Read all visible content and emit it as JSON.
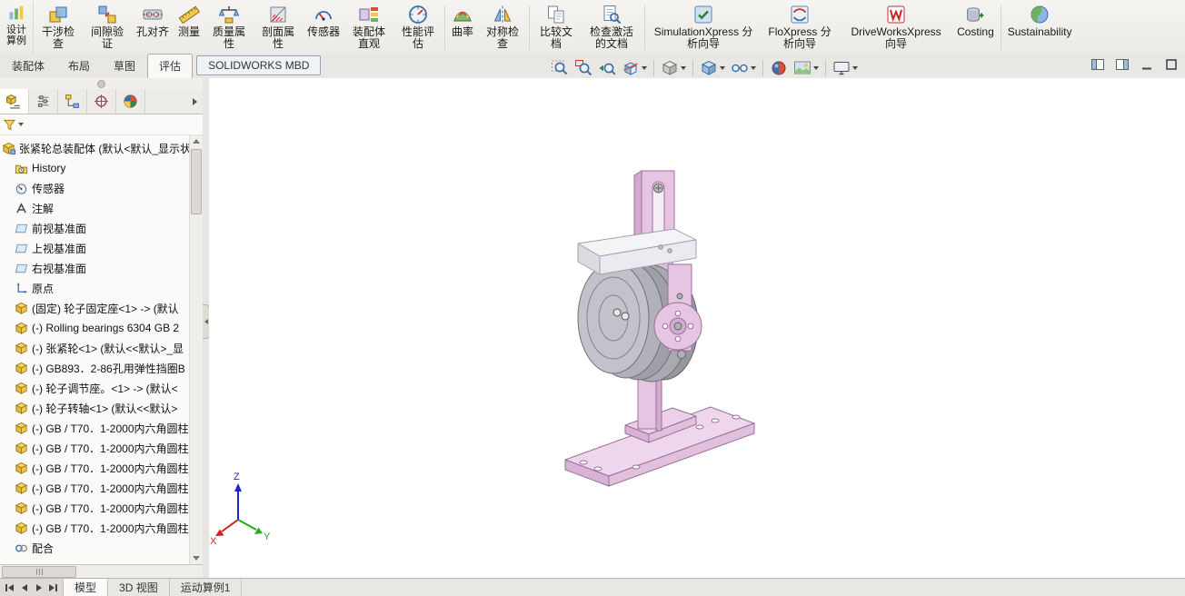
{
  "ribbon": {
    "corner_tool": {
      "label": "设计算例",
      "icon": "design-study"
    },
    "tools": [
      {
        "label": "干涉检查",
        "icon": "interference-detection"
      },
      {
        "label": "间隙验证",
        "icon": "clearance-verification"
      },
      {
        "label": "孔对齐",
        "icon": "hole-alignment"
      },
      {
        "label": "测量",
        "icon": "measure"
      },
      {
        "label": "质量属性",
        "icon": "mass-properties"
      },
      {
        "label": "剖面属性",
        "icon": "section-properties"
      },
      {
        "label": "传感器",
        "icon": "sensor"
      },
      {
        "label": "装配体直观",
        "icon": "assembly-visualization"
      },
      {
        "label": "性能评估",
        "icon": "performance-evaluation"
      },
      {
        "label": "曲率",
        "icon": "curvature"
      },
      {
        "label": "对称检查",
        "icon": "symmetry-check"
      },
      {
        "label": "比较文档",
        "icon": "compare-documents"
      },
      {
        "label": "检查激活的文档",
        "icon": "check-active-document"
      },
      {
        "label": "SimulationXpress 分析向导",
        "icon": "simulationxpress-wizard"
      },
      {
        "label": "FloXpress 分析向导",
        "icon": "floxpress-wizard"
      },
      {
        "label": "DriveWorksXpress 向导",
        "icon": "driveworksxpress-wizard"
      },
      {
        "label": "Costing",
        "icon": "costing"
      },
      {
        "label": "Sustainability",
        "icon": "sustainability"
      }
    ]
  },
  "command_tabs": [
    {
      "label": "装配体",
      "active": false
    },
    {
      "label": "布局",
      "active": false
    },
    {
      "label": "草图",
      "active": false
    },
    {
      "label": "评估",
      "active": true
    },
    {
      "label": "SOLIDWORKS MBD",
      "active": false
    }
  ],
  "headsup_toolbar": {
    "icons": [
      "zoom-to-fit",
      "zoom-to-area",
      "previous-view",
      "section-view",
      "view-orientation",
      "display-style",
      "hide-show-items",
      "edit-appearance",
      "apply-scene",
      "view-settings"
    ]
  },
  "window_controls": {
    "icons": [
      "pane-left",
      "pane-right",
      "minimize",
      "restore"
    ]
  },
  "feature_panel": {
    "tabs": [
      "featuremanager-design-tree",
      "property-manager",
      "configuration-manager",
      "dimxpert-manager",
      "display-manager"
    ],
    "filter_icon": "filter-funnel",
    "root": {
      "label": "张紧轮总装配体 (默认<默认_显示状",
      "icon": "assembly"
    },
    "items": [
      {
        "label": "History",
        "icon": "history-folder"
      },
      {
        "label": "传感器",
        "icon": "sensors"
      },
      {
        "label": "注解",
        "icon": "annotations"
      },
      {
        "label": "前视基准面",
        "icon": "plane"
      },
      {
        "label": "上视基准面",
        "icon": "plane"
      },
      {
        "label": "右视基准面",
        "icon": "plane"
      },
      {
        "label": "原点",
        "icon": "origin"
      },
      {
        "label": "(固定) 轮子固定座<1> -> (默认",
        "icon": "part"
      },
      {
        "label": "(-) Rolling bearings 6304 GB 2",
        "icon": "part"
      },
      {
        "label": "(-) 张紧轮<1> (默认<<默认>_显",
        "icon": "part"
      },
      {
        "label": "(-) GB893．2-86孔用弹性挡圈B",
        "icon": "part"
      },
      {
        "label": "(-) 轮子调节座。<1> -> (默认<",
        "icon": "part"
      },
      {
        "label": "(-) 轮子转轴<1> (默认<<默认>",
        "icon": "part"
      },
      {
        "label": "(-) GB / T70．1-2000内六角圆柱",
        "icon": "part"
      },
      {
        "label": "(-) GB / T70．1-2000内六角圆柱",
        "icon": "part"
      },
      {
        "label": "(-) GB / T70．1-2000内六角圆柱",
        "icon": "part"
      },
      {
        "label": "(-) GB / T70．1-2000内六角圆柱",
        "icon": "part"
      },
      {
        "label": "(-) GB / T70．1-2000内六角圆柱",
        "icon": "part"
      },
      {
        "label": "(-) GB / T70．1-2000内六角圆柱",
        "icon": "part"
      },
      {
        "label": "配合",
        "icon": "mates"
      }
    ]
  },
  "viewport": {
    "triad": {
      "x": "X",
      "y": "Y",
      "z": "Z"
    },
    "model_colors": {
      "part_pink": "#e6c5e3",
      "pulley_gray": "#b1b1b9",
      "bracket_white": "#f4f3f6"
    }
  },
  "bottom_bar": {
    "nav_icons": [
      "first-tab",
      "previous-tab",
      "next-tab",
      "last-tab"
    ],
    "tabs": [
      {
        "label": "模型",
        "active": true
      },
      {
        "label": "3D 视图",
        "active": false
      },
      {
        "label": "运动算例1",
        "active": false
      }
    ]
  }
}
